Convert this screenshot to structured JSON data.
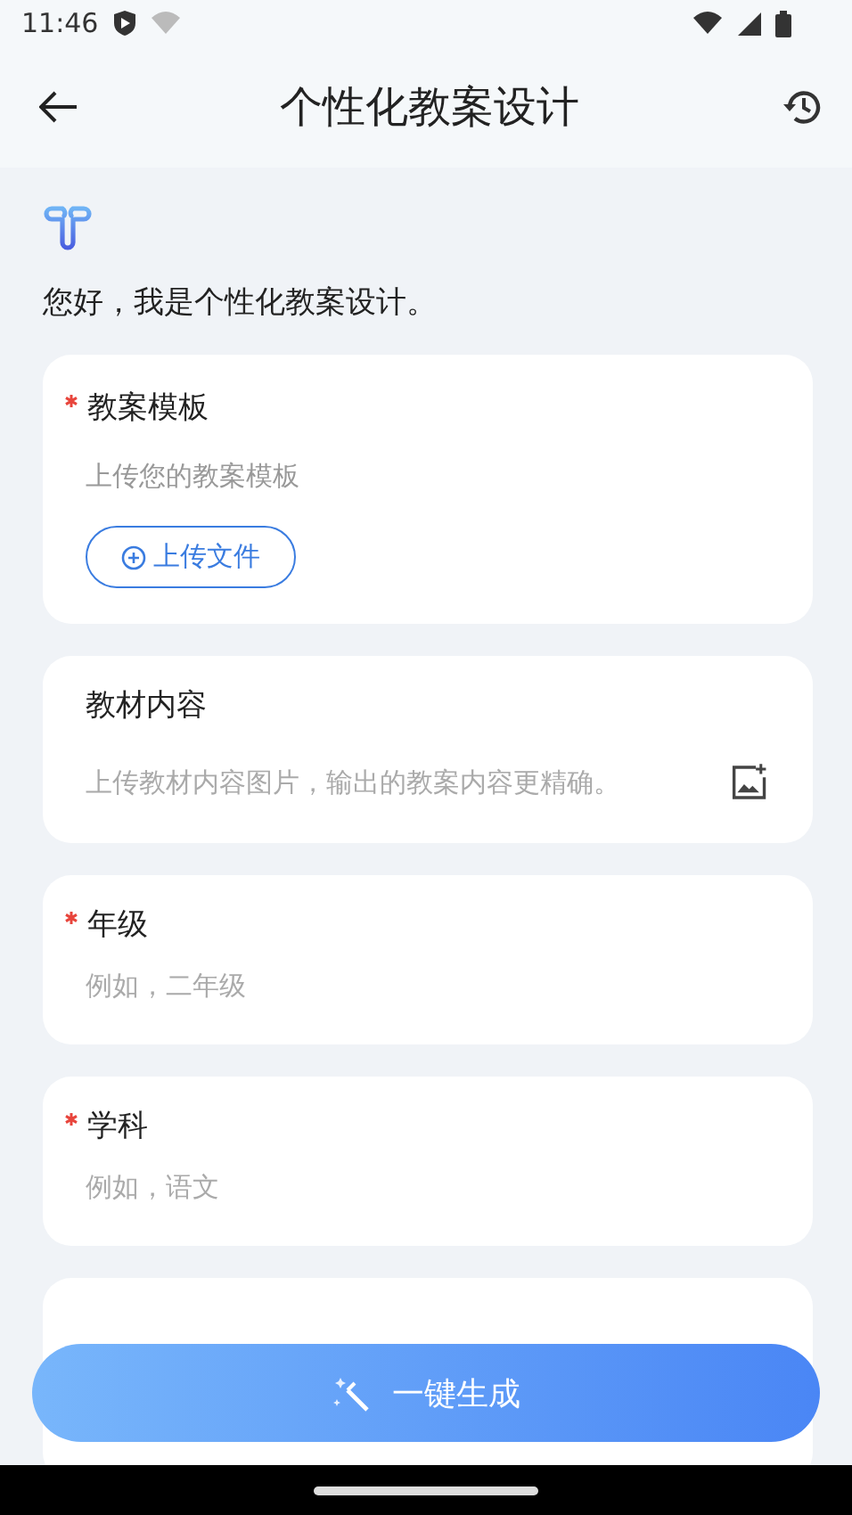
{
  "status_bar": {
    "time": "11:46"
  },
  "header": {
    "title": "个性化教案设计"
  },
  "greeting": "您好，我是个性化教案设计。",
  "fields": [
    {
      "kind": "upload",
      "label": "教案模板",
      "required": true,
      "hint": "上传您的教案模板",
      "button": "上传文件"
    },
    {
      "kind": "image",
      "label": "教材内容",
      "required": false,
      "placeholder": "上传教材内容图片，输出的教案内容更精确。"
    },
    {
      "kind": "text",
      "label": "年级",
      "required": true,
      "placeholder": "例如，二年级"
    },
    {
      "kind": "text",
      "label": "学科",
      "required": true,
      "placeholder": "例如，语文"
    }
  ],
  "generate_button": "一键生成"
}
